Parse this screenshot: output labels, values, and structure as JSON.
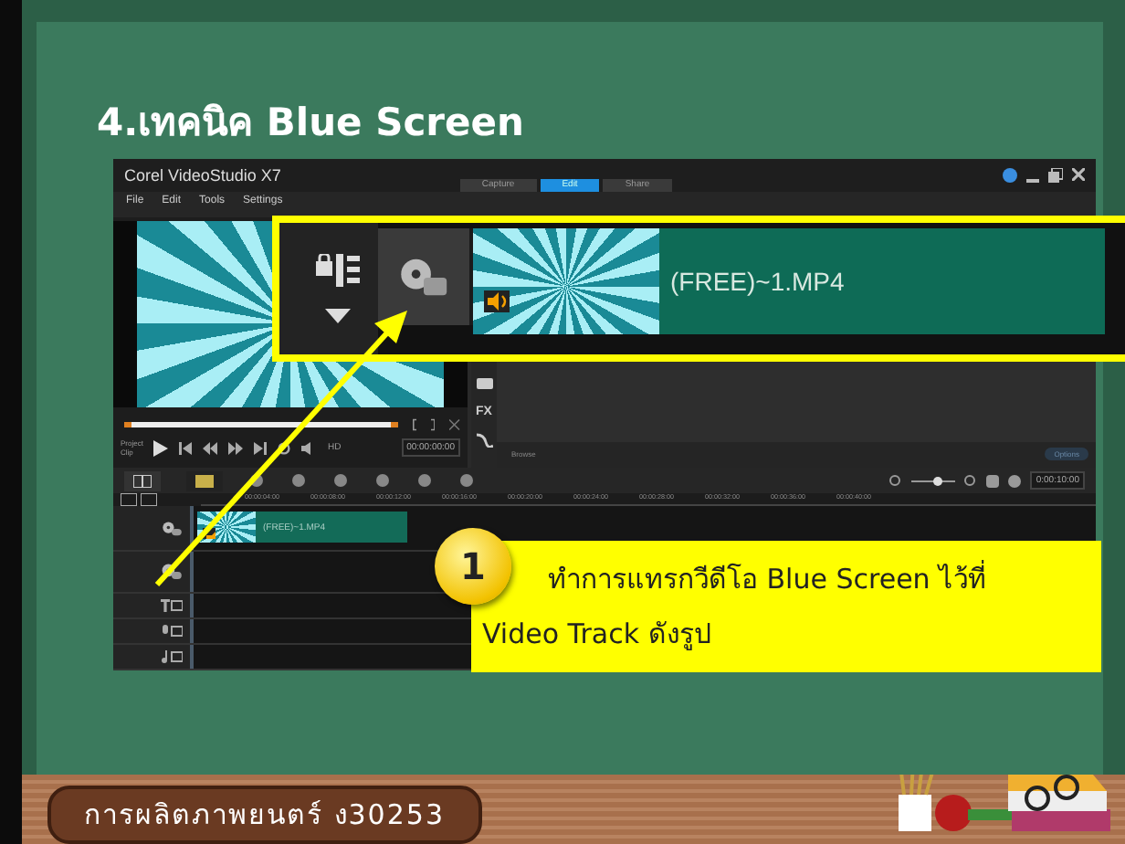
{
  "slide": {
    "title": "4.เทคนิค Blue Screen",
    "footer": "การผลิตภาพยนตร์ ง30253"
  },
  "app": {
    "title": "Corel VideoStudio X7",
    "tabs": [
      {
        "label": "Capture",
        "selected": false
      },
      {
        "label": "Edit",
        "selected": true
      },
      {
        "label": "Share",
        "selected": false
      }
    ],
    "menu": [
      "File",
      "Edit",
      "Tools",
      "Settings"
    ],
    "player": {
      "modes": [
        "Project",
        "Clip"
      ],
      "quality": "HD",
      "timecode": "00:00:00:00"
    },
    "library": {
      "effects": "FX",
      "browse": "Browse",
      "options": "Options"
    },
    "timeline": {
      "ruler": [
        "00:00:04:00",
        "00:00:08:00",
        "00:00:12:00",
        "00:00:16:00",
        "00:00:20:00",
        "00:00:24:00",
        "00:00:28:00",
        "00:00:32:00",
        "00:00:36:00",
        "00:00:40:00"
      ],
      "timecode": "0:00:10:00",
      "zoom": {
        "level": 0.6
      },
      "tracks": [
        {
          "kind": "video",
          "clip": "(FREE)~1.MP4"
        },
        {
          "kind": "overlay"
        },
        {
          "kind": "title"
        },
        {
          "kind": "voice"
        },
        {
          "kind": "music"
        }
      ]
    }
  },
  "zoom_callout": {
    "clip": "(FREE)~1.MP4"
  },
  "step": {
    "number": "1",
    "lines": [
      "ทำการแทรกวีดีโอ Blue Screen ไว้ที่",
      "Video Track ดังรูป"
    ]
  }
}
